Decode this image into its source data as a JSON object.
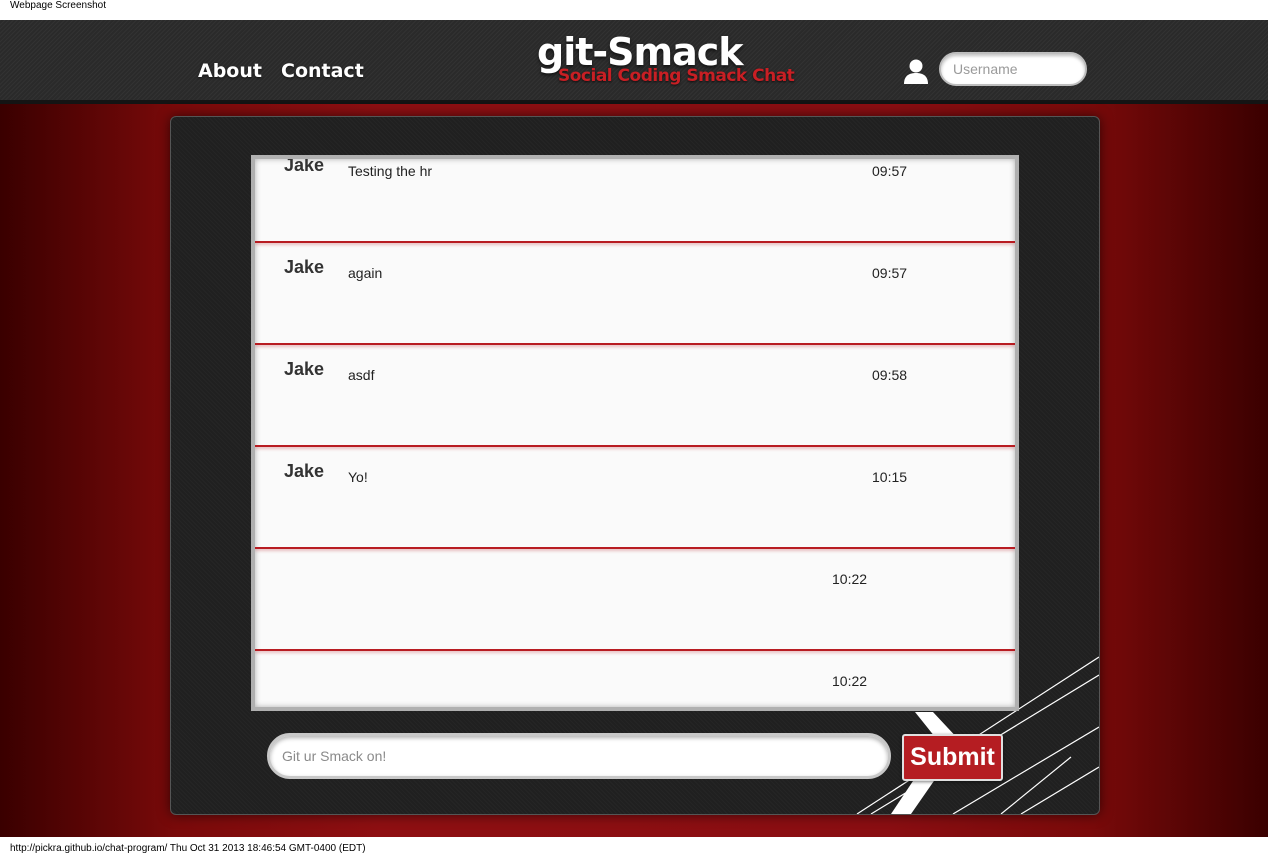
{
  "window": {
    "caption": "Webpage Screenshot",
    "footer": "http://pickra.github.io/chat-program/ Thu Oct 31 2013 18:46:54 GMT-0400 (EDT)"
  },
  "header": {
    "nav": [
      {
        "label": "About"
      },
      {
        "label": "Contact"
      }
    ],
    "logo": {
      "title": "git-Smack",
      "subtitle": "Social Coding Smack Chat"
    },
    "username": {
      "placeholder": "Username",
      "value": ""
    }
  },
  "chat": {
    "messages": [
      {
        "name": "Jake",
        "text": "Testing the hr",
        "time": "09:57"
      },
      {
        "name": "Jake",
        "text": "again",
        "time": "09:57"
      },
      {
        "name": "Jake",
        "text": "asdf",
        "time": "09:58"
      },
      {
        "name": "Jake",
        "text": "Yo!",
        "time": "10:15"
      },
      {
        "name": "",
        "text": "",
        "time": "10:22"
      },
      {
        "name": "",
        "text": "",
        "time": "10:22"
      }
    ],
    "input": {
      "placeholder": "Git ur Smack on!",
      "value": ""
    },
    "submit_label": "Submit"
  },
  "colors": {
    "accent": "#b51d22",
    "header_bg": "#2a2a2a",
    "page_bg": "#8e0f12"
  },
  "icons": {
    "user": "user-icon"
  }
}
